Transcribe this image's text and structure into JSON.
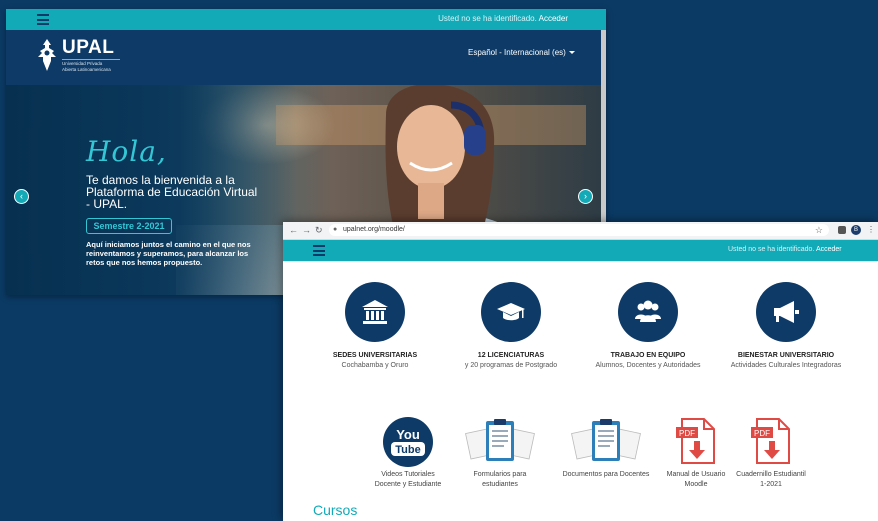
{
  "back_window": {
    "login_text": "Usted no se ha identificado.",
    "login_link": "Acceder",
    "logo": {
      "title": "UPAL",
      "subtitle_1": "Universidad Privada",
      "subtitle_2": "Abierta Latinoamericana"
    },
    "language": "Español - Internacional (es)",
    "hero": {
      "greeting": "Hola,",
      "welcome": "Te damos la bienvenida a la Plataforma de Educación Virtual - UPAL.",
      "semester": "Semestre 2-2021",
      "description": "Aquí iniciamos juntos el camino en el que nos reinventamos y superamos, para alcanzar los retos que nos hemos propuesto."
    }
  },
  "front_window": {
    "url": "upalnet.org/moodle/",
    "login_text": "Usted no se ha identificado.",
    "login_link": "Acceder",
    "features": [
      {
        "title": "SEDES UNIVERSITARIAS",
        "subtitle": "Cochabamba y Oruro",
        "icon": "building-icon"
      },
      {
        "title": "12 LICENCIATURAS",
        "subtitle": "y 20 programas de Postgrado",
        "icon": "graduation-cap-icon"
      },
      {
        "title": "TRABAJO EN EQUIPO",
        "subtitle": "Alumnos, Docentes y Autoridades",
        "icon": "team-icon"
      },
      {
        "title": "BIENESTAR UNIVERSITARIO",
        "subtitle": "Actividades Culturales Integradoras",
        "icon": "megaphone-icon"
      }
    ],
    "resources": [
      {
        "label_1": "Videos Tutoriales",
        "label_2": "Docente y Estudiante",
        "icon": "youtube-icon"
      },
      {
        "label_1": "Formularios para estudiantes",
        "label_2": "",
        "icon": "clipboard-icon"
      },
      {
        "label_1": "Documentos para Docentes",
        "label_2": "",
        "icon": "clipboard-icon"
      },
      {
        "label_1": "Manual de Usuario",
        "label_2": "Moodle",
        "icon": "pdf-download-icon"
      },
      {
        "label_1": "Cuadernillo Estudiantil",
        "label_2": "1-2021",
        "icon": "pdf-download-icon"
      }
    ],
    "youtube_text_1": "You",
    "youtube_text_2": "Tube",
    "pdf_text": "PDF",
    "section_title": "Cursos"
  },
  "colors": {
    "navy": "#0d3a66",
    "teal": "#13aab8",
    "pdf_red": "#e04a45"
  }
}
